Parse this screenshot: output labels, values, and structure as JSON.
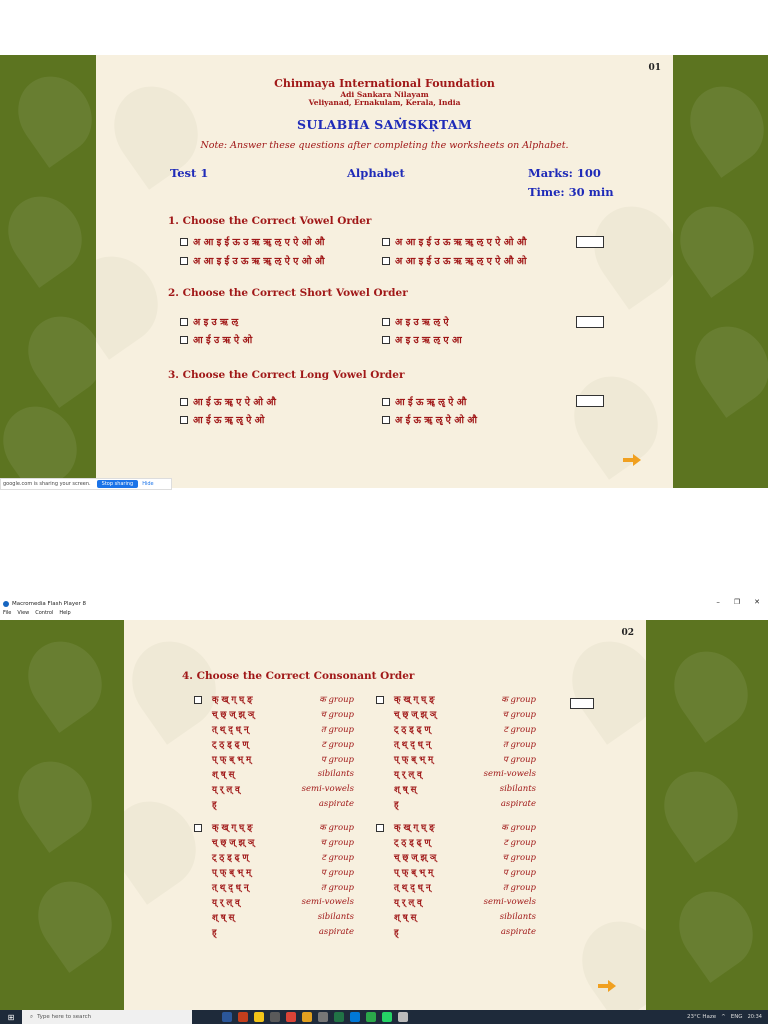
{
  "slide1": {
    "page_number": "01",
    "org_name": "Chinmaya International Foundation",
    "org_line1": "Adi Sankara Nilayam",
    "org_line2": "Veliyanad, Ernakulam, Kerala, India",
    "course": "SULABHA SAṀSKṚTAM",
    "note": "Note: Answer these questions after completing the worksheets on Alphabet.",
    "test_label": "Test 1",
    "topic": "Alphabet",
    "marks": "Marks: 100",
    "time": "Time: 30 min",
    "questions": [
      {
        "title": "1. Choose the Correct Vowel Order",
        "options": [
          "अ आ इ ई ऊ उ ऋ ॠ ऌ ए ऐ ओ औ",
          "अ आ इ ई उ ऊ ऋ ॠ ऌ ए ऐ ओ औ",
          "अ आ इ ई उ ऊ ऋ ॠ ऌ ऐ ए ओ औ",
          "अ आ इ ई उ ऊ ऋ ॠ ऌ ए ऐ औ ओ"
        ]
      },
      {
        "title": "2. Choose the Correct Short Vowel Order",
        "options": [
          "अ इ उ ऋ ऌ",
          "अ इ उ ऋ ऌ ऐ",
          "आ ई उ ऋ ऐ ओ",
          "अ इ उ ऋ ऌ ए आ"
        ]
      },
      {
        "title": "3. Choose the Correct Long Vowel Order",
        "options": [
          "आ ई ऊ ॠ ए ऐ ओ औ",
          "आ ई ऊ ॠ ॡ ऐ औ",
          "आ ई ऊ ॠ ॡ ऐ ओ",
          "अ ई ऊ ॠ ॡ ऐ ओ औ"
        ]
      }
    ]
  },
  "share_bar": {
    "text": "google.com is sharing your screen.",
    "stop": "Stop sharing",
    "hide": "Hide"
  },
  "window": {
    "title": "Macromedia Flash Player 8",
    "menu": [
      "File",
      "View",
      "Control",
      "Help"
    ],
    "minimize": "–",
    "maximize": "❐",
    "close": "✕"
  },
  "slide2": {
    "page_number": "02",
    "question_title": "4. Choose the Correct Consonant Order",
    "options": [
      {
        "rows": [
          [
            "क् ख् ग् घ् ङ्",
            "क group"
          ],
          [
            "च् छ् ज् झ् ञ्",
            "च group"
          ],
          [
            "त् थ् द् ध् न्",
            "त group"
          ],
          [
            "ट् ठ् ड् ढ् ण्",
            "ट group"
          ],
          [
            "प् फ् ब् भ् म्",
            "प group"
          ],
          [
            "श् ष् स्",
            "sibilants"
          ],
          [
            "य् र् ल् व्",
            "semi-vowels"
          ],
          [
            "ह्",
            "aspirate"
          ]
        ]
      },
      {
        "rows": [
          [
            "क् ख् ग् घ् ङ्",
            "क group"
          ],
          [
            "च् छ् ज् झ् ञ्",
            "च group"
          ],
          [
            "ट् ठ् ड् ढ् ण्",
            "ट group"
          ],
          [
            "त् थ् द् ध् न्",
            "त group"
          ],
          [
            "प् फ् ब् भ् म्",
            "प group"
          ],
          [
            "य् र् ल् व्",
            "semi-vowels"
          ],
          [
            "श् ष् स्",
            "sibilants"
          ],
          [
            "ह्",
            "aspirate"
          ]
        ]
      },
      {
        "rows": [
          [
            "क् ख् ग् घ् ङ्",
            "क group"
          ],
          [
            "च् छ् ज् झ् ञ्",
            "च group"
          ],
          [
            "ट् ठ् ड् ढ् ण्",
            "ट group"
          ],
          [
            "प् फ् ब् भ् म्",
            "प group"
          ],
          [
            "त् थ् द् ध् न्",
            "त group"
          ],
          [
            "य् र् ल् व्",
            "semi-vowels"
          ],
          [
            "श् ष् स्",
            "sibilants"
          ],
          [
            "ह्",
            "aspirate"
          ]
        ]
      },
      {
        "rows": [
          [
            "क् ख् ग् घ् ङ्",
            "क group"
          ],
          [
            "ट् ठ् ड् ढ् ण्",
            "ट group"
          ],
          [
            "च् छ् ज् झ् ञ्",
            "च group"
          ],
          [
            "प् फ् ब् भ् म्",
            "प group"
          ],
          [
            "त् थ् द् ध् न्",
            "त group"
          ],
          [
            "य् र् ल् व्",
            "semi-vowels"
          ],
          [
            "श् ष् स्",
            "sibilants"
          ],
          [
            "ह्",
            "aspirate"
          ]
        ]
      }
    ]
  },
  "taskbar": {
    "search_placeholder": "Type here to search",
    "weather": "23°C Haze",
    "lang": "ENG",
    "time": "20:34"
  },
  "colors": {
    "green": "#5c7420",
    "panel": "#f7f0df",
    "red": "#a01818",
    "blue": "#1f2bb8",
    "arrow": "#f0a020"
  }
}
